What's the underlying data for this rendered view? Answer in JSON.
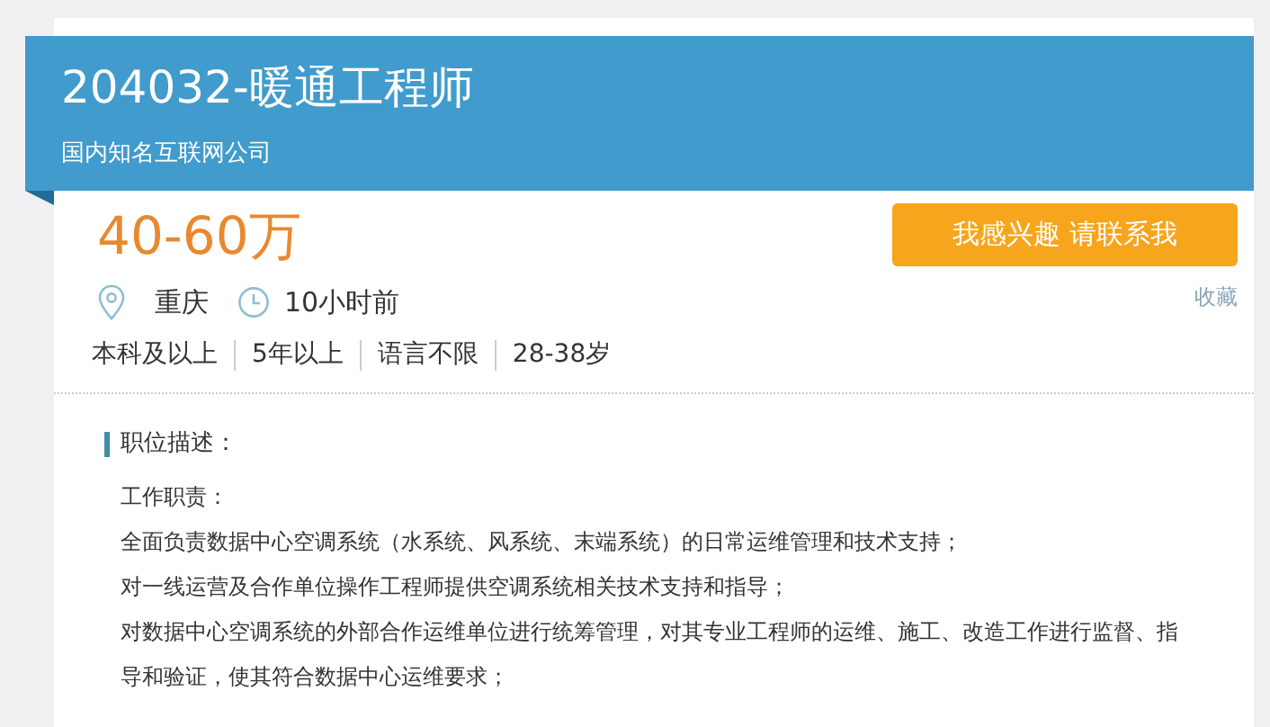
{
  "header": {
    "title": "204032-暖通工程师",
    "company": "国内知名互联网公司"
  },
  "salary": "40-60万",
  "apply_button": "我感兴趣 请联系我",
  "favorite_link": "收藏",
  "location": "重庆",
  "posted": "10小时前",
  "requirements": [
    "本科及以上",
    "5年以上",
    "语言不限",
    "28-38岁"
  ],
  "description": {
    "heading": "职位描述：",
    "lines": [
      "工作职责：",
      "全面负责数据中心空调系统（水系统、风系统、末端系统）的日常运维管理和技术支持；",
      "对一线运营及合作单位操作工程师提供空调系统相关技术支持和指导；",
      "对数据中心空调系统的外部合作运维单位进行统筹管理，对其专业工程师的运维、施工、改造工作进行监督、指",
      "导和验证，使其符合数据中心运维要求；"
    ]
  }
}
